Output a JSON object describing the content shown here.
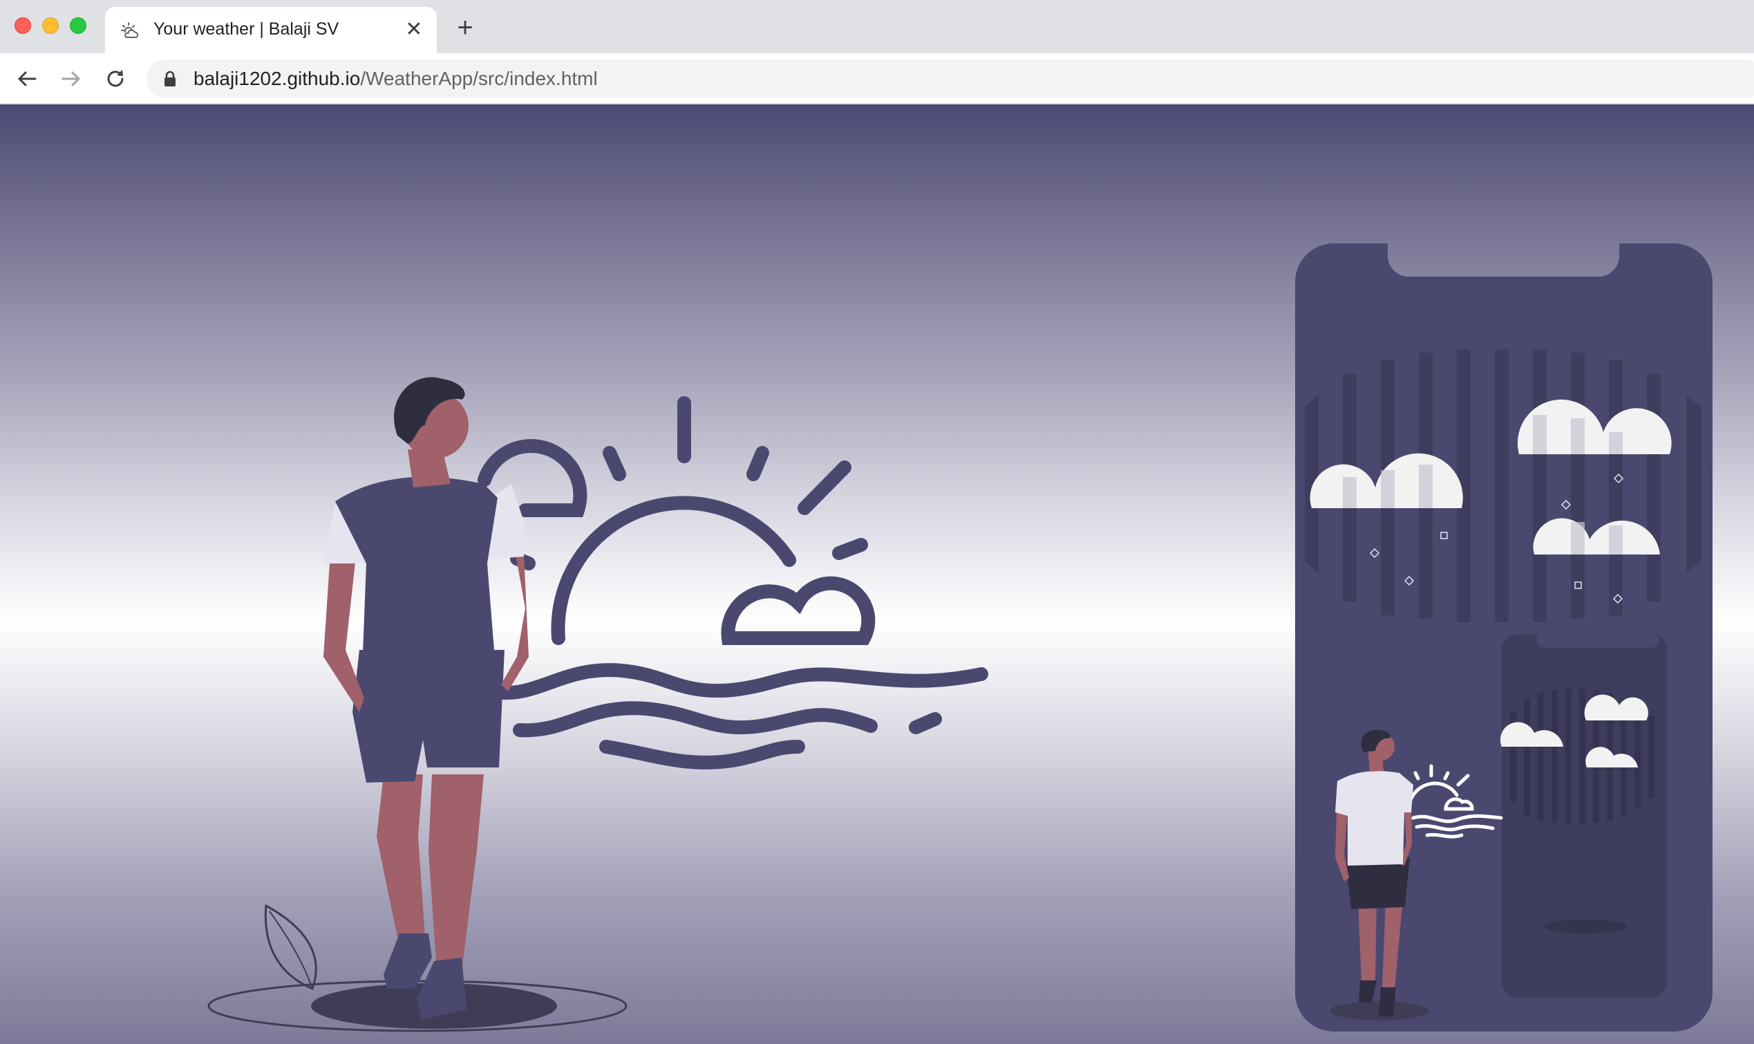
{
  "browser": {
    "tab": {
      "title": "Your weather | Balaji SV",
      "icon": "weather-favicon-icon",
      "close_label": "✕"
    },
    "new_tab_label": "+",
    "nav": {
      "back_icon": "arrow-left-icon",
      "forward_icon": "arrow-right-icon",
      "reload_icon": "reload-icon"
    },
    "address": {
      "host": "balaji1202.github.io",
      "path": "/WeatherApp/src/index.html",
      "lock_icon": "lock-icon"
    }
  },
  "page": {
    "illustrations": [
      "person-standing",
      "sunrise-over-waves",
      "phone-with-weather-clouds",
      "mini-phone",
      "mini-person"
    ]
  },
  "colors": {
    "accent": "#4b4870",
    "skin": "#a0616a",
    "cloud": "#f2f2f2",
    "shirt": "#e6e4ef"
  }
}
